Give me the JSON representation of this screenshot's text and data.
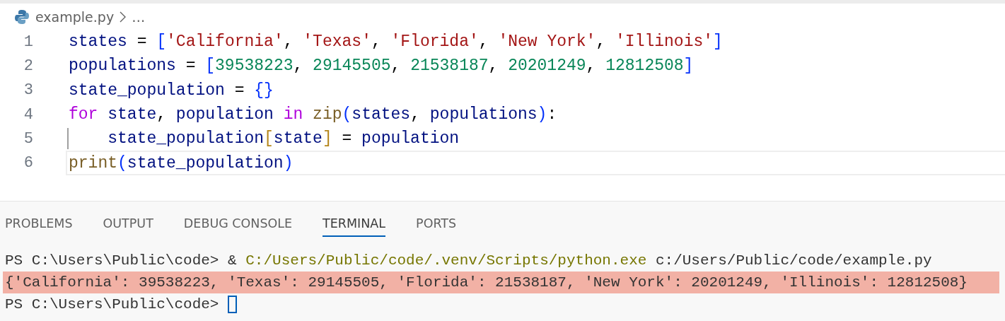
{
  "breadcrumb": {
    "file": "example.py",
    "ellipsis": "…"
  },
  "code_lines": [
    {
      "number": "1",
      "current": false,
      "indent_guide": false,
      "tokens": [
        {
          "kind": "name",
          "text": "states"
        },
        {
          "kind": "op",
          "text": " = "
        },
        {
          "kind": "bracket",
          "text": "["
        },
        {
          "kind": "string",
          "text": "'California'"
        },
        {
          "kind": "op",
          "text": ", "
        },
        {
          "kind": "string",
          "text": "'Texas'"
        },
        {
          "kind": "op",
          "text": ", "
        },
        {
          "kind": "string",
          "text": "'Florida'"
        },
        {
          "kind": "op",
          "text": ", "
        },
        {
          "kind": "string",
          "text": "'New York'"
        },
        {
          "kind": "op",
          "text": ", "
        },
        {
          "kind": "string",
          "text": "'Illinois'"
        },
        {
          "kind": "bracket",
          "text": "]"
        }
      ]
    },
    {
      "number": "2",
      "current": false,
      "indent_guide": false,
      "tokens": [
        {
          "kind": "name",
          "text": "populations"
        },
        {
          "kind": "op",
          "text": " = "
        },
        {
          "kind": "bracket",
          "text": "["
        },
        {
          "kind": "number",
          "text": "39538223"
        },
        {
          "kind": "op",
          "text": ", "
        },
        {
          "kind": "number",
          "text": "29145505"
        },
        {
          "kind": "op",
          "text": ", "
        },
        {
          "kind": "number",
          "text": "21538187"
        },
        {
          "kind": "op",
          "text": ", "
        },
        {
          "kind": "number",
          "text": "20201249"
        },
        {
          "kind": "op",
          "text": ", "
        },
        {
          "kind": "number",
          "text": "12812508"
        },
        {
          "kind": "bracket",
          "text": "]"
        }
      ]
    },
    {
      "number": "3",
      "current": false,
      "indent_guide": false,
      "tokens": [
        {
          "kind": "name",
          "text": "state_population"
        },
        {
          "kind": "op",
          "text": " = "
        },
        {
          "kind": "bracket",
          "text": "{}"
        }
      ]
    },
    {
      "number": "4",
      "current": false,
      "indent_guide": false,
      "tokens": [
        {
          "kind": "keyword",
          "text": "for"
        },
        {
          "kind": "name",
          "text": " state"
        },
        {
          "kind": "op",
          "text": ", "
        },
        {
          "kind": "name",
          "text": "population"
        },
        {
          "kind": "keyword",
          "text": " in"
        },
        {
          "kind": "function",
          "text": " zip"
        },
        {
          "kind": "bracket",
          "text": "("
        },
        {
          "kind": "name",
          "text": "states"
        },
        {
          "kind": "op",
          "text": ", "
        },
        {
          "kind": "name",
          "text": "populations"
        },
        {
          "kind": "bracket",
          "text": ")"
        },
        {
          "kind": "op",
          "text": ":"
        }
      ]
    },
    {
      "number": "5",
      "current": false,
      "indent_guide": true,
      "tokens": [
        {
          "kind": "name",
          "text": "    state_population"
        },
        {
          "kind": "bracket_inner",
          "text": "["
        },
        {
          "kind": "name",
          "text": "state"
        },
        {
          "kind": "bracket_inner",
          "text": "]"
        },
        {
          "kind": "op",
          "text": " = "
        },
        {
          "kind": "name",
          "text": "population"
        }
      ]
    },
    {
      "number": "6",
      "current": true,
      "indent_guide": false,
      "tokens": [
        {
          "kind": "function",
          "text": "print"
        },
        {
          "kind": "bracket",
          "text": "("
        },
        {
          "kind": "name",
          "text": "state_population"
        },
        {
          "kind": "bracket",
          "text": ")"
        }
      ]
    }
  ],
  "panel_tabs": [
    {
      "label": "PROBLEMS",
      "selected": false
    },
    {
      "label": "OUTPUT",
      "selected": false
    },
    {
      "label": "DEBUG CONSOLE",
      "selected": false
    },
    {
      "label": "TERMINAL",
      "selected": true
    },
    {
      "label": "PORTS",
      "selected": false
    }
  ],
  "terminal_lines": [
    {
      "highlighted": false,
      "cursor": false,
      "tokens": [
        {
          "kind": "plain",
          "text": "PS C:\\Users\\Public\\code> & "
        },
        {
          "kind": "path",
          "text": "C:/Users/Public/code/.venv/Scripts/python.exe"
        },
        {
          "kind": "plain",
          "text": " c:/Users/Public/code/example.py"
        }
      ]
    },
    {
      "highlighted": true,
      "cursor": false,
      "tokens": [
        {
          "kind": "plain",
          "text": "{'California': 39538223, 'Texas': 29145505, 'Florida': 21538187, 'New York': 20201249, 'Illinois': 12812508}"
        }
      ]
    },
    {
      "highlighted": false,
      "cursor": true,
      "tokens": [
        {
          "kind": "plain",
          "text": "PS C:\\Users\\Public\\code> "
        }
      ]
    }
  ]
}
